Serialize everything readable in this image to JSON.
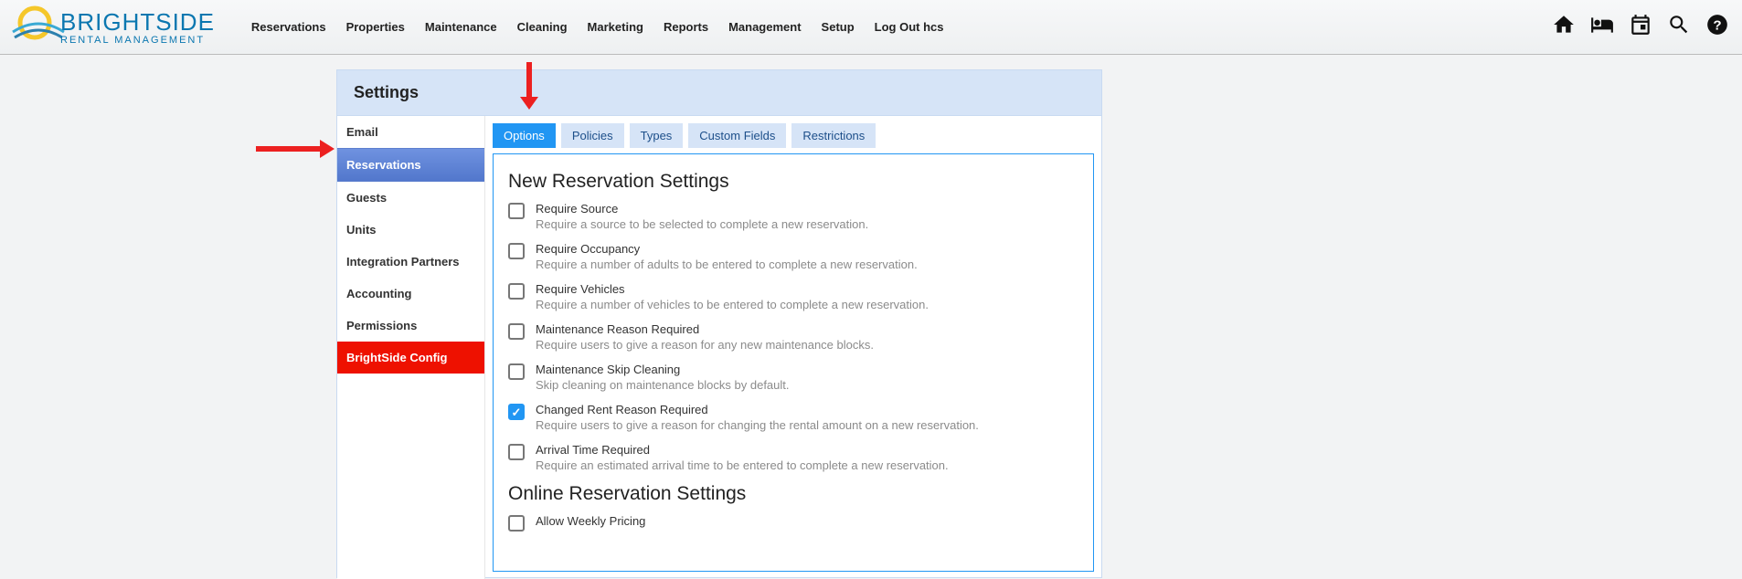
{
  "logo": {
    "brand": "BRIGHTSIDE",
    "sub": "RENTAL MANAGEMENT"
  },
  "nav": [
    "Reservations",
    "Properties",
    "Maintenance",
    "Cleaning",
    "Marketing",
    "Reports",
    "Management",
    "Setup",
    "Log Out hcs"
  ],
  "panel_title": "Settings",
  "sidebar": {
    "items": [
      {
        "label": "Email"
      },
      {
        "label": "Reservations",
        "active": true
      },
      {
        "label": "Guests"
      },
      {
        "label": "Units"
      },
      {
        "label": "Integration Partners"
      },
      {
        "label": "Accounting"
      },
      {
        "label": "Permissions"
      },
      {
        "label": "BrightSide Config",
        "red": true
      }
    ]
  },
  "tabs": [
    {
      "label": "Options",
      "active": true
    },
    {
      "label": "Policies"
    },
    {
      "label": "Types"
    },
    {
      "label": "Custom Fields"
    },
    {
      "label": "Restrictions"
    }
  ],
  "section1_title": "New Reservation Settings",
  "options": [
    {
      "title": "Require Source",
      "desc": "Require a source to be selected to complete a new reservation.",
      "checked": false
    },
    {
      "title": "Require Occupancy",
      "desc": "Require a number of adults to be entered to complete a new reservation.",
      "checked": false
    },
    {
      "title": "Require Vehicles",
      "desc": "Require a number of vehicles to be entered to complete a new reservation.",
      "checked": false
    },
    {
      "title": "Maintenance Reason Required",
      "desc": "Require users to give a reason for any new maintenance blocks.",
      "checked": false
    },
    {
      "title": "Maintenance Skip Cleaning",
      "desc": "Skip cleaning on maintenance blocks by default.",
      "checked": false
    },
    {
      "title": "Changed Rent Reason Required",
      "desc": "Require users to give a reason for changing the rental amount on a new reservation.",
      "checked": true
    },
    {
      "title": "Arrival Time Required",
      "desc": "Require an estimated arrival time to be entered to complete a new reservation.",
      "checked": false
    }
  ],
  "section2_title": "Online Reservation Settings",
  "options2": [
    {
      "title": "Allow Weekly Pricing",
      "desc": "",
      "checked": false
    }
  ]
}
